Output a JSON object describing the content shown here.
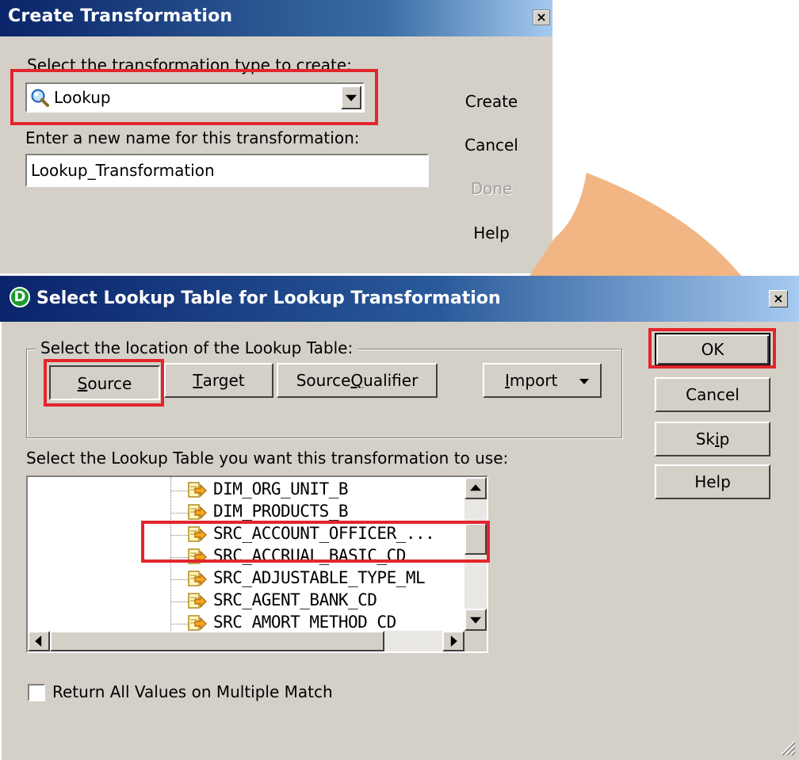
{
  "create_dialog": {
    "title": "Create Transformation",
    "type_label": "Select the transformation type to create:",
    "type_value": "Lookup",
    "type_icon": "lookup-magnifier-icon",
    "name_label": "Enter a new name for this transformation:",
    "name_value": "Lookup_Transformation",
    "buttons": {
      "create": "Create",
      "cancel": "Cancel",
      "done": "Done",
      "help": "Help"
    }
  },
  "lookup_dialog": {
    "title": "Select Lookup Table for Lookup Transformation",
    "app_icon_letter": "D",
    "location_label": "Select the location of the Lookup Table:",
    "location_buttons": {
      "source_prefix": "",
      "source_mnemonic": "S",
      "source_rest": "ource",
      "target_mnemonic": "T",
      "target_rest": "arget",
      "qualifier_prefix": "Source ",
      "qualifier_mnemonic": "Q",
      "qualifier_rest": "ualifier",
      "import_mnemonic": "I",
      "import_rest": "mport"
    },
    "table_label": "Select the Lookup Table you want this transformation to use:",
    "tables": [
      "DIM_ORG_UNIT_B",
      "DIM_PRODUCTS_B",
      "SRC_ACCOUNT_OFFICER_...",
      "SRC_ACCRUAL_BASIC_CD",
      "SRC_ADJUSTABLE_TYPE_ML",
      "SRC_AGENT_BANK_CD",
      "SRC_AMORT_METHOD_CD"
    ],
    "selected_table": "SRC_ACCOUNT_OFFICER_...",
    "checkbox_label": "Return All Values on Multiple Match",
    "checkbox_checked": false,
    "side_buttons": {
      "ok": "OK",
      "cancel": "Cancel",
      "skip_prefix": "Sk",
      "skip_mnemonic": "i",
      "skip_rest": "p",
      "help": "Help"
    }
  },
  "colors": {
    "title_bar": "#0a246a",
    "highlight_box": "#e2262c",
    "arc": "#f1b684",
    "dialog_face": "#d4d0c8"
  }
}
